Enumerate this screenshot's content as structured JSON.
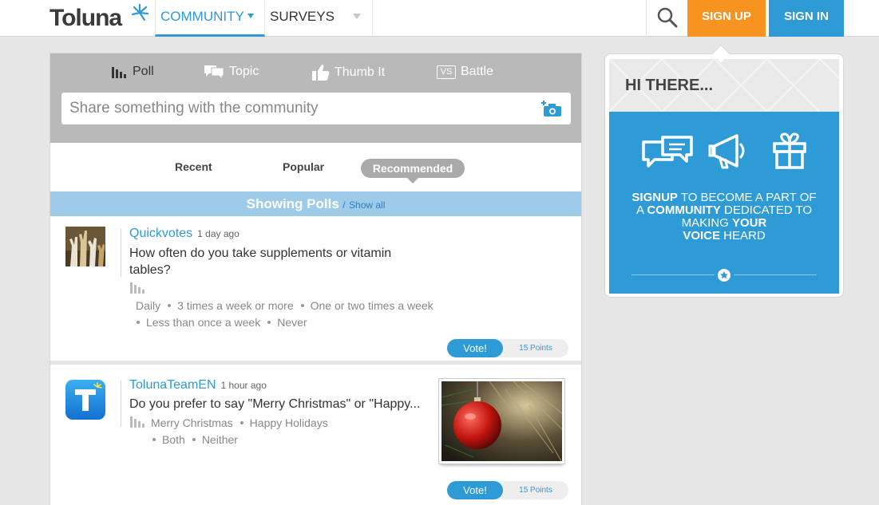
{
  "header": {
    "logo": "Toluna",
    "nav": [
      {
        "label": "COMMUNITY"
      },
      {
        "label": "SURVEYS"
      }
    ],
    "signup": "SIGN UP",
    "signin": "SIGN IN"
  },
  "composer": {
    "types": [
      "Poll",
      "Topic",
      "Thumb It",
      "Battle"
    ],
    "battle_badge": "VS",
    "placeholder": "Share something with the community"
  },
  "tabs": [
    "Recent",
    "Popular",
    "Recommended"
  ],
  "filter": {
    "showing": "Showing Polls",
    "sep": "/",
    "show_all": "Show all"
  },
  "posts": [
    {
      "author": "Quickvotes",
      "ago": "1 day ago",
      "question_line1": "How often do you take supplements or vitamin",
      "question_line2": "tables?",
      "options": [
        "Daily",
        "3 times a week or more",
        "One or two times a week",
        "Less than once a week",
        "Never"
      ],
      "vote": "Vote!",
      "points": "15 Points"
    },
    {
      "author": "TolunaTeamEN",
      "ago": "1 hour ago",
      "question": "Do you prefer to say \"Merry Christmas\" or \"Happy...",
      "options": [
        "Merry Christmas",
        "Happy Holidays",
        "Both",
        "Neither"
      ],
      "vote": "Vote!",
      "points": "15 Points"
    }
  ],
  "promo": {
    "title": "HI THERE...",
    "t1": "SIGNUP",
    "t2": " TO BECOME A PART OF",
    "t3": "A ",
    "t4": "COMMUNITY",
    "t5": " DEDICATED TO MAKING ",
    "t6": "YOUR",
    "t7": "VOICE",
    "t8": " HEARD"
  },
  "colors": {
    "brand_blue": "#2e9ad6",
    "signup_orange": "#f7931e",
    "filter_bar": "#9dcbe8"
  }
}
